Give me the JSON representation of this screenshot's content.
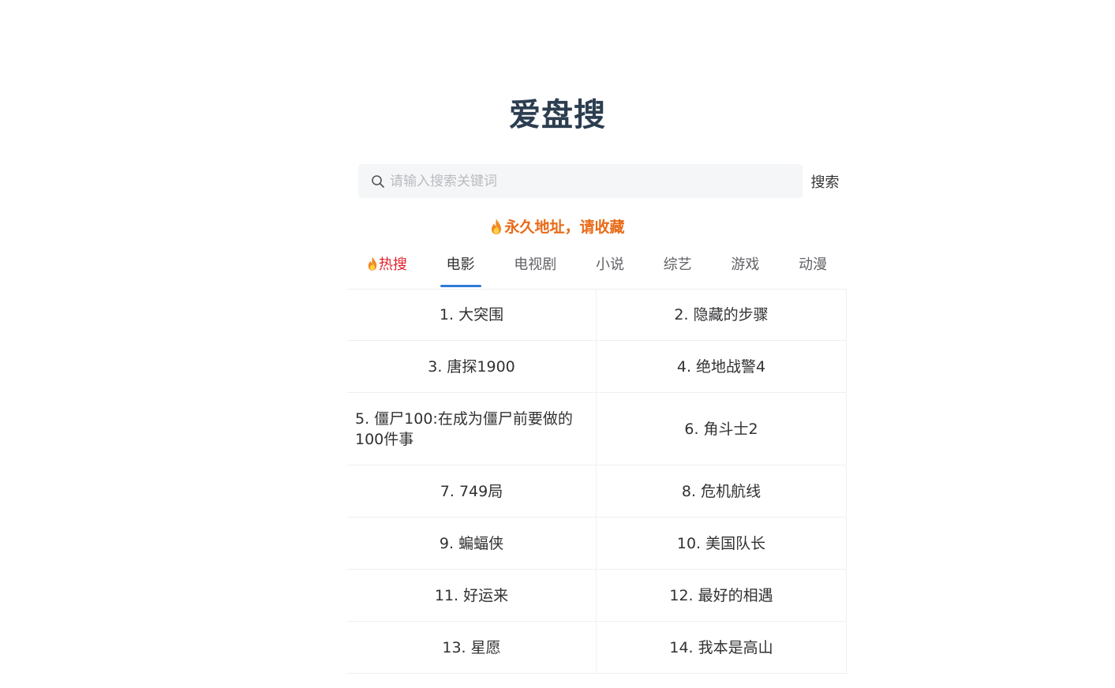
{
  "site": {
    "title": "爱盘搜"
  },
  "search": {
    "placeholder": "请输入搜索关键词",
    "button_label": "搜索"
  },
  "notice": {
    "text": "永久地址，请收藏",
    "icon": "fire-icon",
    "color": "#e86a17"
  },
  "tabs": [
    {
      "label": "热搜",
      "icon": "fire-icon",
      "state": "hot"
    },
    {
      "label": "电影",
      "state": "active"
    },
    {
      "label": "电视剧"
    },
    {
      "label": "小说"
    },
    {
      "label": "综艺"
    },
    {
      "label": "游戏"
    },
    {
      "label": "动漫"
    }
  ],
  "list": {
    "items": [
      "1. 大突围",
      "2. 隐藏的步骤",
      "3. 唐探1900",
      "4. 绝地战警4",
      "5. 僵尸100:在成为僵尸前要做的100件事",
      "6. 角斗士2",
      "7. 749局",
      "8. 危机航线",
      "9. 蝙蝠侠",
      "10. 美国队长",
      "11. 好运来",
      "12. 最好的相遇",
      "13. 星愿",
      "14. 我本是高山"
    ]
  },
  "colors": {
    "title": "#2c3e50",
    "accent": "#2f7ad7",
    "hot": "#e3222c",
    "notice": "#e86a17"
  }
}
